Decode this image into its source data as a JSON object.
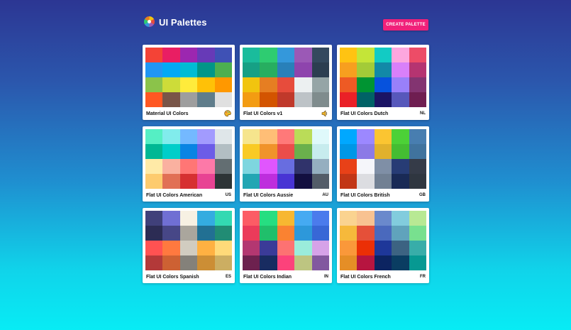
{
  "app": {
    "title": "UI Palettes",
    "create_label": "CREATE PALETTE"
  },
  "palettes": [
    {
      "name": "Material UI Colors",
      "code": "",
      "icon": "palette-icon",
      "colors": [
        "#f44336",
        "#e91e63",
        "#9c27b0",
        "#673ab7",
        "#3f51b5",
        "#2196f3",
        "#03a9f4",
        "#00bcd4",
        "#009688",
        "#4caf50",
        "#8bc34a",
        "#cddc39",
        "#ffeb3b",
        "#ffc107",
        "#ff9800",
        "#ff5722",
        "#795548",
        "#9e9e9e",
        "#607d8b",
        "#e0e0e0"
      ]
    },
    {
      "name": "Flat UI Colors v1",
      "code": "",
      "icon": "speaker-icon",
      "colors": [
        "#1abc9c",
        "#2ecc71",
        "#3498db",
        "#9b59b6",
        "#34495e",
        "#16a085",
        "#27ae60",
        "#2980b9",
        "#8e44ad",
        "#2c3e50",
        "#f1c40f",
        "#e67e22",
        "#e74c3c",
        "#ecf0f1",
        "#95a5a6",
        "#f39c12",
        "#d35400",
        "#c0392b",
        "#bdc3c7",
        "#7f8c8d"
      ]
    },
    {
      "name": "Flat UI Colors Dutch",
      "code": "NL",
      "icon": "",
      "colors": [
        "#ffc312",
        "#c4e538",
        "#12cbc4",
        "#fda7df",
        "#ed4c67",
        "#f79f1f",
        "#a3cb38",
        "#1289a7",
        "#d980fa",
        "#b53471",
        "#ee5a24",
        "#009432",
        "#0652dd",
        "#9980fa",
        "#833471",
        "#ea2027",
        "#006266",
        "#1b1464",
        "#5758bb",
        "#6f1e51"
      ]
    },
    {
      "name": "Flat UI Colors American",
      "code": "US",
      "icon": "",
      "colors": [
        "#55efc4",
        "#81ecec",
        "#74b9ff",
        "#a29bfe",
        "#dfe6e9",
        "#00b894",
        "#00cec9",
        "#0984e3",
        "#6c5ce7",
        "#b2bec3",
        "#ffeaa7",
        "#fab1a0",
        "#ff7675",
        "#fd79a8",
        "#636e72",
        "#fdcb6e",
        "#e17055",
        "#d63031",
        "#e84393",
        "#2d3436"
      ]
    },
    {
      "name": "Flat UI Colors Aussie",
      "code": "AU",
      "icon": "",
      "colors": [
        "#f6e58d",
        "#ffbe76",
        "#ff7979",
        "#badc58",
        "#dff9fb",
        "#f9ca24",
        "#f0932b",
        "#eb4d4b",
        "#6ab04c",
        "#c7ecee",
        "#7ed6df",
        "#e056fd",
        "#686de0",
        "#30336b",
        "#95afc0",
        "#22a6b3",
        "#be2edd",
        "#4834d4",
        "#130f40",
        "#535c68"
      ]
    },
    {
      "name": "Flat UI Colors British",
      "code": "GB",
      "icon": "",
      "colors": [
        "#00a8ff",
        "#9c88ff",
        "#fbc531",
        "#4cd137",
        "#487eb0",
        "#0097e6",
        "#8c7ae6",
        "#e1b12c",
        "#44bd32",
        "#40739e",
        "#e84118",
        "#f5f6fa",
        "#7f8fa6",
        "#273c75",
        "#353b48",
        "#c23616",
        "#dcdde1",
        "#718093",
        "#192a56",
        "#2f3640"
      ]
    },
    {
      "name": "Flat UI Colors Spanish",
      "code": "ES",
      "icon": "",
      "colors": [
        "#40407a",
        "#706fd3",
        "#f7f1e3",
        "#34ace0",
        "#33d9b2",
        "#2c2c54",
        "#474787",
        "#aaa69d",
        "#227093",
        "#218c74",
        "#ff5252",
        "#ff793f",
        "#d1ccc0",
        "#ffb142",
        "#ffda79",
        "#b33939",
        "#cd6133",
        "#84817a",
        "#cc8e35",
        "#ccae62"
      ]
    },
    {
      "name": "Flat UI Colors Indian",
      "code": "IN",
      "icon": "",
      "colors": [
        "#fc5c65",
        "#26de81",
        "#f7b731",
        "#45aaf2",
        "#4b7bec",
        "#eb3b5a",
        "#20bf6b",
        "#fa8231",
        "#2d98da",
        "#3867d6",
        "#b33771",
        "#3b3b98",
        "#fd7272",
        "#9aecdb",
        "#d6a2e8",
        "#6d214f",
        "#182c61",
        "#fc427b",
        "#bdc581",
        "#82589f"
      ]
    },
    {
      "name": "Flat UI Colors French",
      "code": "FR",
      "icon": "",
      "colors": [
        "#fad390",
        "#f8c291",
        "#6a89cc",
        "#82ccdd",
        "#b8e994",
        "#f6b93b",
        "#e55039",
        "#4a69bd",
        "#60a3bc",
        "#78e08f",
        "#fa983a",
        "#eb2f06",
        "#1e3799",
        "#3c6382",
        "#38ada9",
        "#e58e26",
        "#b71540",
        "#0c2461",
        "#0a3d62",
        "#079992"
      ]
    }
  ]
}
